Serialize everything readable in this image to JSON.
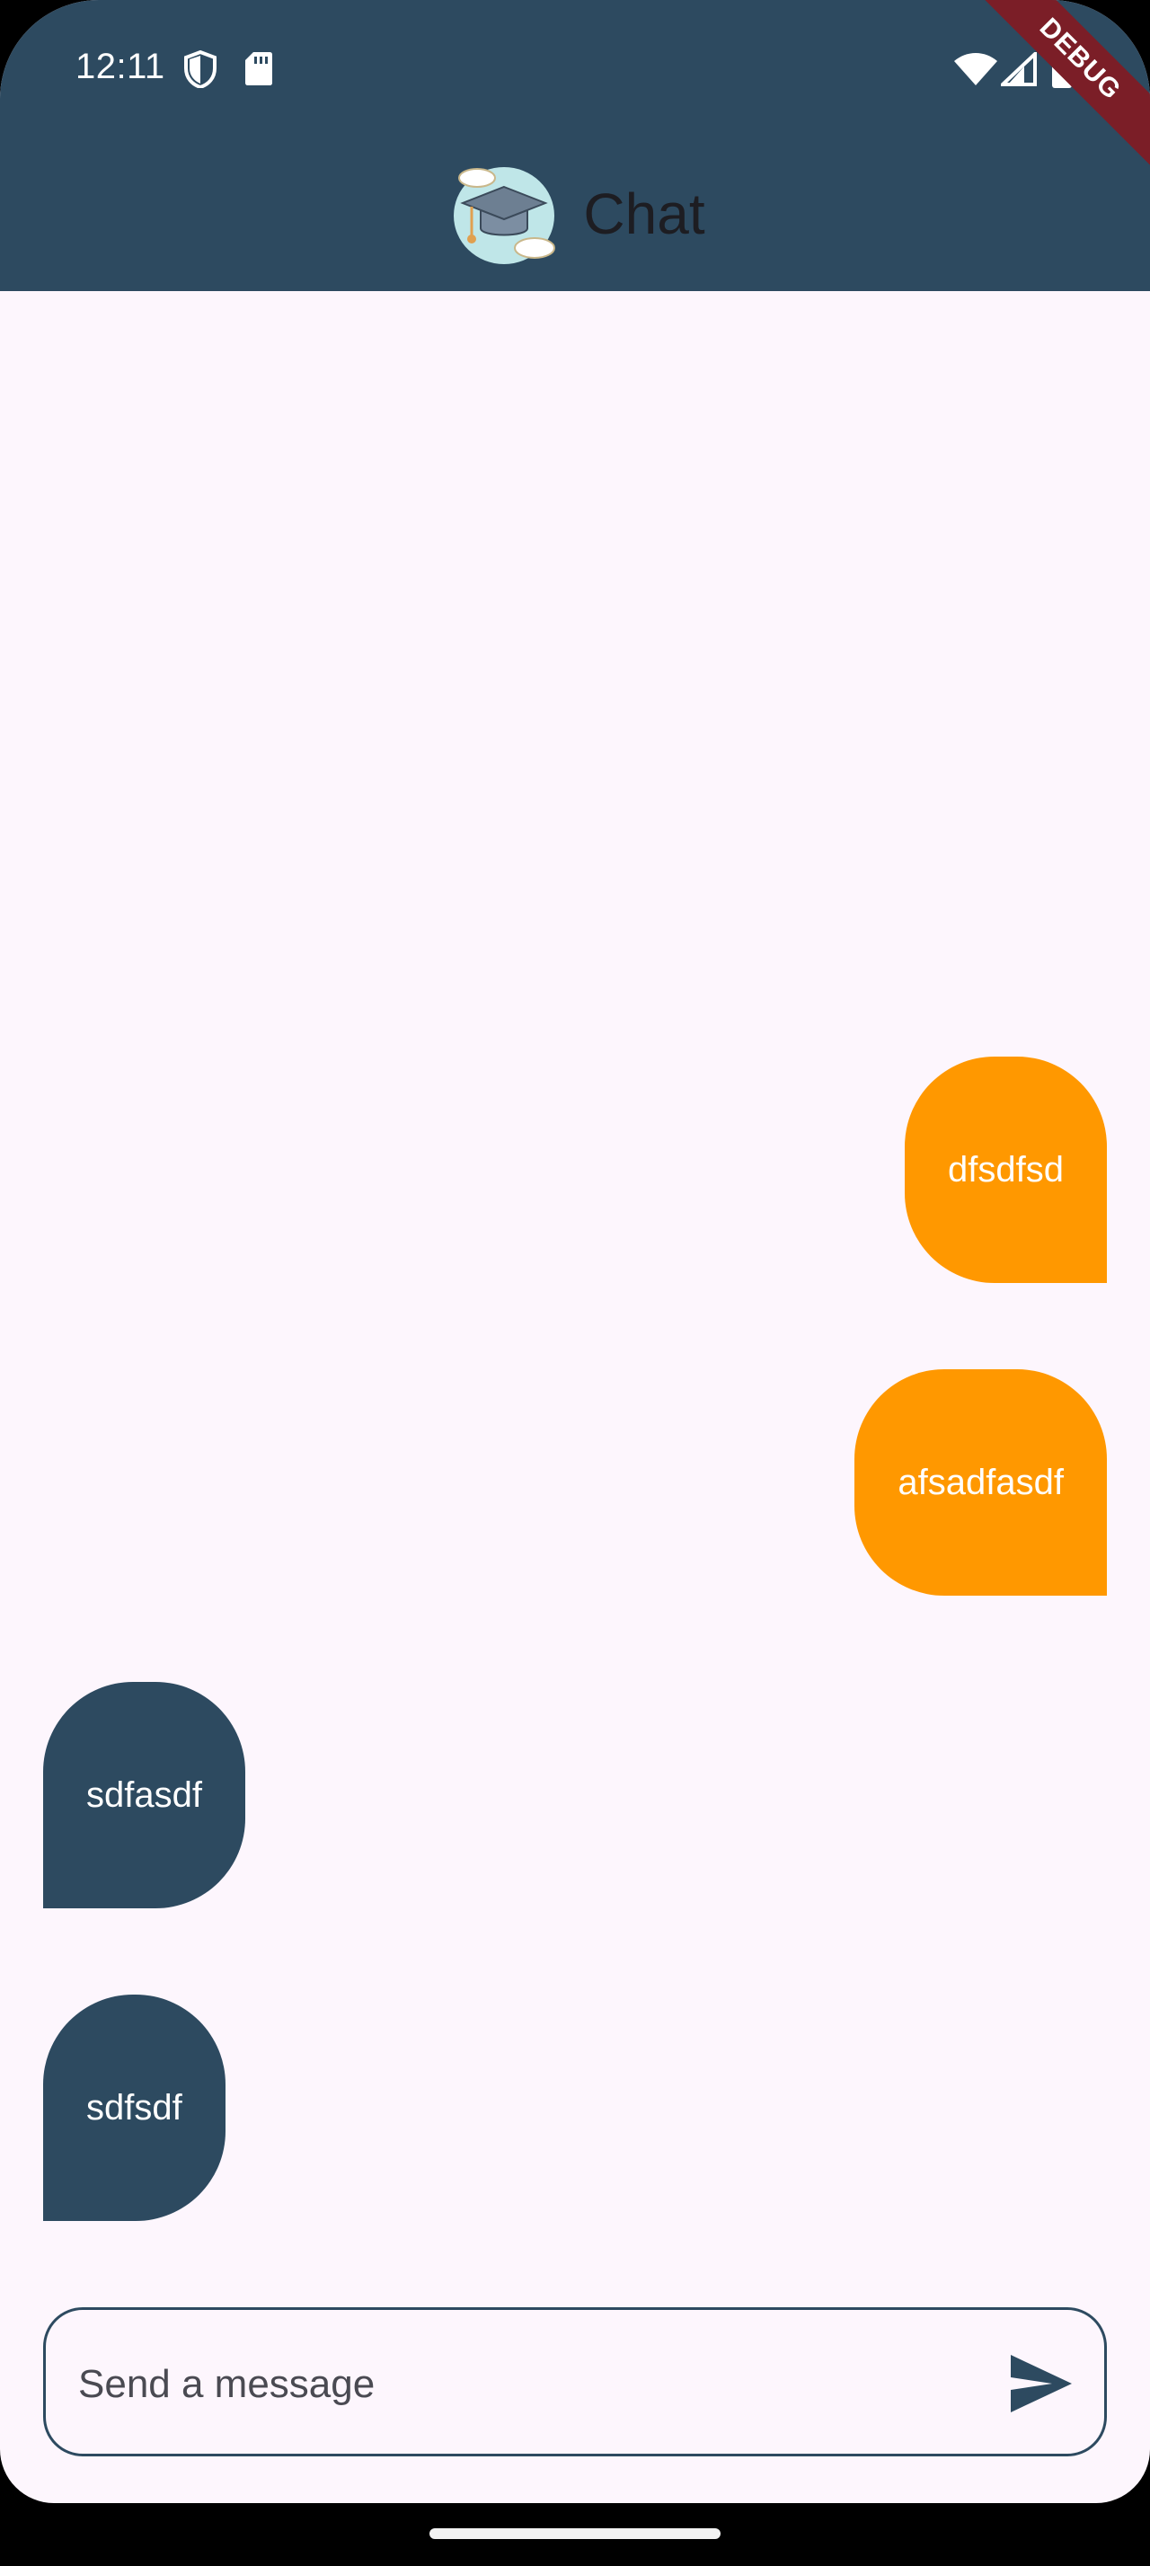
{
  "status_bar": {
    "time": "12:11",
    "debug_label": "DEBUG"
  },
  "header": {
    "title": "Chat",
    "logo_icon": "graduation-cap-cloud-icon"
  },
  "messages": [
    {
      "id": "m1",
      "text": "dfsdfsd",
      "side": "sent"
    },
    {
      "id": "m2",
      "text": "afsadfasdf",
      "side": "sent"
    },
    {
      "id": "m3",
      "text": "sdfasdf",
      "side": "received"
    },
    {
      "id": "m4",
      "text": "sdfsdf",
      "side": "received"
    }
  ],
  "composer": {
    "placeholder": "Send a message",
    "value": "",
    "send_icon": "send-icon"
  },
  "colors": {
    "primary": "#2d4a60",
    "accent": "#ff9800",
    "background": "#fdf6fd",
    "debug": "#7b1e27"
  }
}
